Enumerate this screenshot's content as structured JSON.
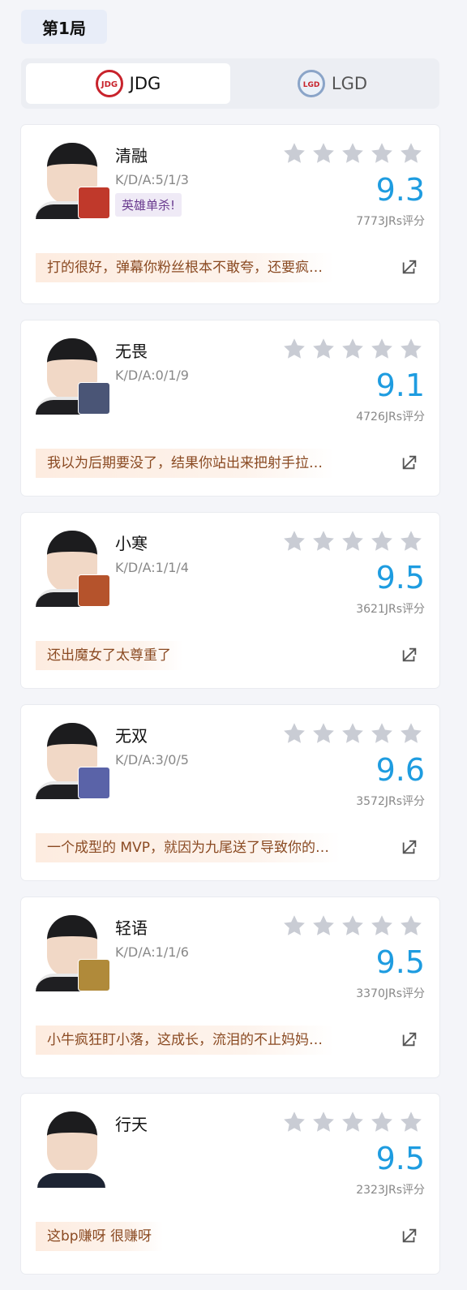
{
  "round": {
    "label": "第1局"
  },
  "teams": [
    {
      "name": "JDG",
      "logo_text": "JDG",
      "active": true
    },
    {
      "name": "LGD",
      "logo_text": "LGD",
      "active": false
    }
  ],
  "colors": {
    "score": "#1e9ce0",
    "comment_text": "#8a4a22",
    "star": "#c9ccd4",
    "tag_bg": "#efeaf6"
  },
  "players": [
    {
      "name": "清融",
      "kda": "K/D/A:5/1/3",
      "tag": "英雄单杀!",
      "score": "9.3",
      "raters": "7773JRs评分",
      "comment": "打的很好，弹幕你粉丝根本不敢夸，还要疯…",
      "stars": 5,
      "hero_color": "#c0392b"
    },
    {
      "name": "无畏",
      "kda": "K/D/A:0/1/9",
      "tag": "",
      "score": "9.1",
      "raters": "4726JRs评分",
      "comment": "我以为后期要没了，结果你站出来把射手拉…",
      "stars": 5,
      "hero_color": "#4a5576"
    },
    {
      "name": "小寒",
      "kda": "K/D/A:1/1/4",
      "tag": "",
      "score": "9.5",
      "raters": "3621JRs评分",
      "comment": "还出魔女了太尊重了",
      "stars": 5,
      "hero_color": "#b5532c"
    },
    {
      "name": "无双",
      "kda": "K/D/A:3/0/5",
      "tag": "",
      "score": "9.6",
      "raters": "3572JRs评分",
      "comment": "一个成型的 MVP，就因为九尾送了导致你的…",
      "stars": 5,
      "hero_color": "#5a63a8"
    },
    {
      "name": "轻语",
      "kda": "K/D/A:1/1/6",
      "tag": "",
      "score": "9.5",
      "raters": "3370JRs评分",
      "comment": "小牛疯狂盯小落，这成长，流泪的不止妈妈…",
      "stars": 5,
      "hero_color": "#b08a3a"
    },
    {
      "name": "行天",
      "kda": "",
      "tag": "",
      "score": "9.5",
      "raters": "2323JRs评分",
      "comment": "这bp赚呀 很赚呀",
      "stars": 5,
      "hero_color": ""
    }
  ]
}
